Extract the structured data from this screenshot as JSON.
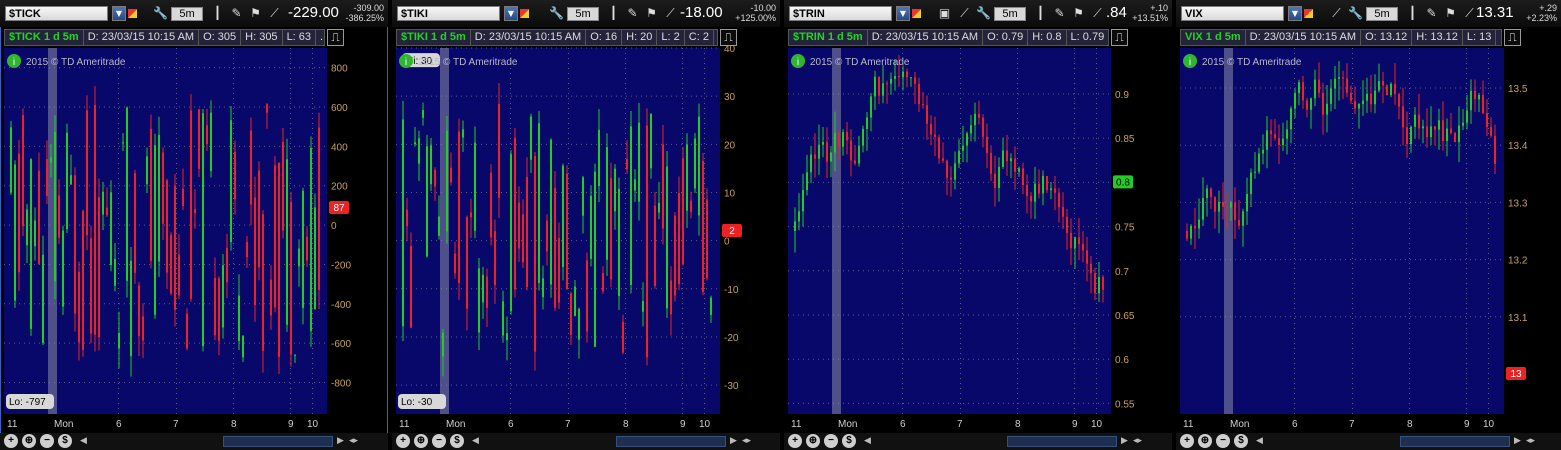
{
  "colors": {
    "up": "#22cc22",
    "down": "#ee2222",
    "plot_bg": "#08086a",
    "axis_text": "#c8a060",
    "grid": "#5a5a8a"
  },
  "watermark": "2015 © TD Ameritrade",
  "info_icon": "i",
  "toolbar": {
    "timeframe": "5m"
  },
  "bottom_icons": [
    "zoom-in-icon",
    "zoom-out-icon",
    "dollar-icon"
  ],
  "panels": [
    {
      "id": "tick",
      "symbol": "$TICK",
      "last": "-229.00",
      "chg_abs": "-309.00",
      "chg_pct": "-386.25%",
      "header": {
        "title": "$TICK 1 d 5m",
        "date": "D: 23/03/15 10:15 AM",
        "open": "O: 305",
        "high": "H: 305",
        "low": "L: 63",
        "close": ""
      },
      "current_value": "87",
      "hi_label": "",
      "lo_label": "Lo: -797",
      "chart_data": {
        "type": "candlestick",
        "x_labels": [
          "11",
          "Mon",
          "6",
          "7",
          "8",
          "9",
          "10"
        ],
        "y_ticks": [
          "800",
          "600",
          "400",
          "200",
          "0",
          "-200",
          "-400",
          "-600",
          "-800"
        ],
        "ylim": [
          -960,
          900
        ],
        "current": 87,
        "low": -797,
        "low_label": "Lo: -797",
        "seed": 11
      }
    },
    {
      "id": "tiki",
      "symbol": "$TIKI",
      "last": "-18.00",
      "chg_abs": "-10.00",
      "chg_pct": "+125.00%",
      "header": {
        "title": "$TIKI 1 d 5m",
        "date": "D: 23/03/15 10:15 AM",
        "open": "O: 16",
        "high": "H: 20",
        "low": "L: 2",
        "close": "C: 2"
      },
      "current_value": "2",
      "hi_label": "Hi: 30",
      "lo_label": "Lo: -30",
      "chart_data": {
        "type": "candlestick",
        "x_labels": [
          "11",
          "Mon",
          "6",
          "7",
          "8",
          "9",
          "10"
        ],
        "y_ticks": [
          "40",
          "30",
          "20",
          "10",
          "0",
          "-10",
          "-20",
          "-30"
        ],
        "ylim": [
          -36,
          40
        ],
        "current": 2,
        "high": 30,
        "low": -30,
        "high_label": "Hi: 30",
        "low_label": "Lo: -30",
        "seed": 23
      }
    },
    {
      "id": "trin",
      "symbol": "$TRIN",
      "last": ".84",
      "chg_abs": "+.10",
      "chg_pct": "+13.51%",
      "header": {
        "title": "$TRIN 1 d 5m",
        "date": "D: 23/03/15 10:15 AM",
        "open": "O: 0.79",
        "high": "H: 0.8",
        "low": "L: 0.79",
        "close": ""
      },
      "current_value": "0.8",
      "hi_label": "",
      "lo_label": "",
      "chart_data": {
        "type": "candlestick",
        "x_labels": [
          "11",
          "Mon",
          "6",
          "7",
          "8",
          "9",
          "10"
        ],
        "y_ticks": [
          "0.9",
          "0.85",
          "0.8",
          "0.75",
          "0.7",
          "0.65",
          "0.6",
          "0.55"
        ],
        "ylim": [
          0.538,
          0.952
        ],
        "current": 0.8,
        "seed": 37
      }
    },
    {
      "id": "vix",
      "symbol": "VIX",
      "last": "13.31",
      "chg_abs": "+.29",
      "chg_pct": "+2.23%",
      "header": {
        "title": "VIX 1 d 5m",
        "date": "D: 23/03/15 10:15 AM",
        "open": "O: 13.12",
        "high": "H: 13.12",
        "low": "L: 13",
        "close": ""
      },
      "current_value": "13",
      "hi_label": "",
      "lo_label": "",
      "chart_data": {
        "type": "candlestick",
        "x_labels": [
          "11",
          "Mon",
          "6",
          "7",
          "8",
          "9",
          "10"
        ],
        "y_ticks": [
          "13.5",
          "13.4",
          "13.3",
          "13.2",
          "13.1"
        ],
        "ylim": [
          12.93,
          13.57
        ],
        "current": 13.0,
        "seed": 51
      }
    }
  ]
}
